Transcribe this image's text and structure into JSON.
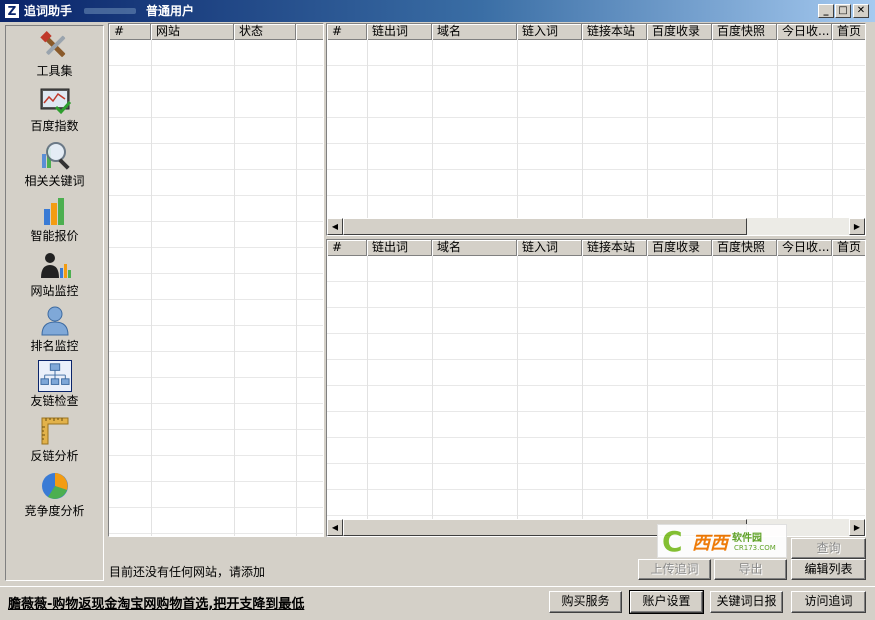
{
  "window": {
    "app_icon": "Z",
    "title": "追词助手",
    "user_role": "普通用户",
    "controls": {
      "minimize": "_",
      "maximize": "□",
      "close": "✕"
    }
  },
  "sidebar": {
    "items": [
      {
        "label": "工具集",
        "icon": "tools-icon"
      },
      {
        "label": "百度指数",
        "icon": "index-chart-icon"
      },
      {
        "label": "相关关键词",
        "icon": "magnifier-icon"
      },
      {
        "label": "智能报价",
        "icon": "bar-chart-icon"
      },
      {
        "label": "网站监控",
        "icon": "person-chart-icon"
      },
      {
        "label": "排名监控",
        "icon": "user-icon"
      },
      {
        "label": "友链检查",
        "icon": "sitemap-icon"
      },
      {
        "label": "反链分析",
        "icon": "ruler-icon"
      },
      {
        "label": "竞争度分析",
        "icon": "pie-chart-icon"
      }
    ],
    "selected": "友链检查"
  },
  "site_grid": {
    "columns": [
      "#",
      "网站",
      "状态"
    ]
  },
  "links_grid": {
    "columns": [
      "#",
      "链出词",
      "域名",
      "链入词",
      "链接本站",
      "百度收录",
      "百度快照",
      "今日收...",
      "首页"
    ]
  },
  "status_text": "目前还没有任何网站，请添加",
  "actions": {
    "query": "查询",
    "upload": "上传追词",
    "export": "导出",
    "edit_list": "编辑列表"
  },
  "footer": {
    "ad_text": "膽薇薇-购物返现金淘宝网购物首选,把开支降到最低",
    "buy": "购买服务",
    "account": "账户设置",
    "keyword_report": "关键词日报",
    "visit": "访问追词"
  },
  "scroll": {
    "left": "◀",
    "right": "▶"
  },
  "watermark": {
    "main": "西西",
    "sub": "软件园",
    "url": "CR173.COM"
  }
}
